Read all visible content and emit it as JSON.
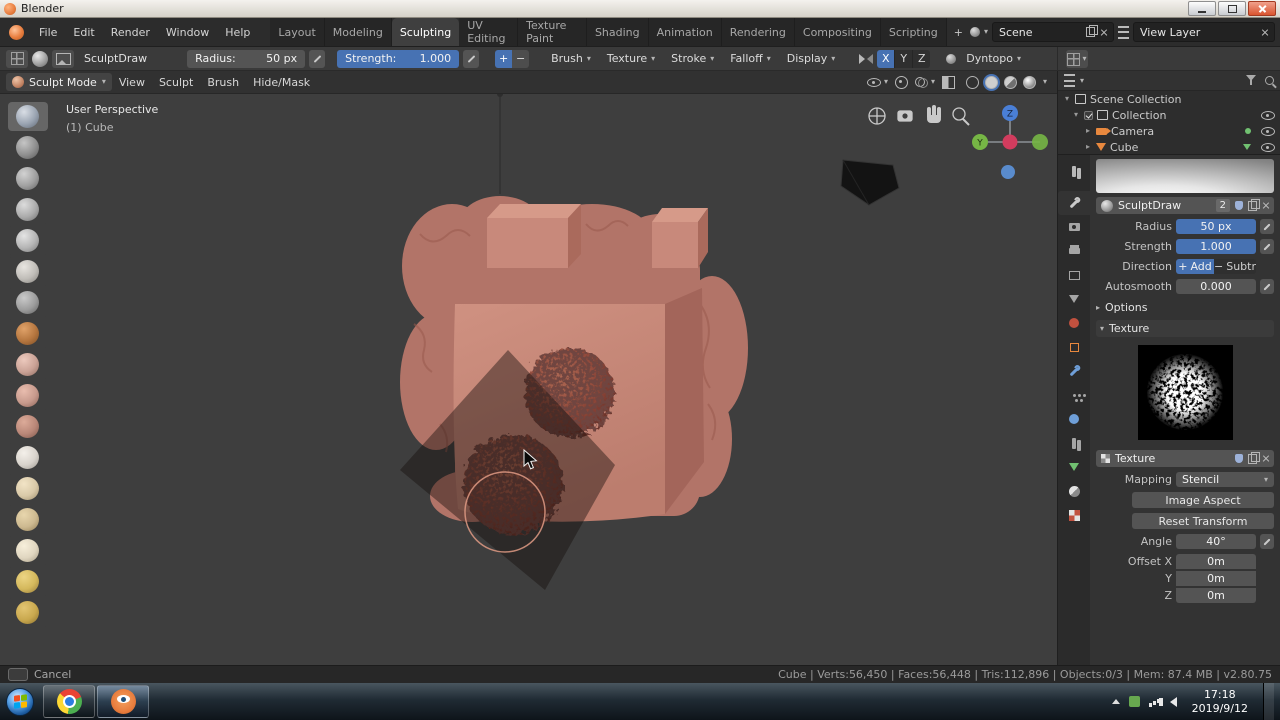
{
  "window": {
    "title": "Blender"
  },
  "icons": {
    "chevron_down": "▾",
    "caret_right": "▸"
  },
  "topbar": {
    "menus": [
      "File",
      "Edit",
      "Render",
      "Window",
      "Help"
    ],
    "tabs": [
      "Layout",
      "Modeling",
      "Sculpting",
      "UV Editing",
      "Texture Paint",
      "Shading",
      "Animation",
      "Rendering",
      "Compositing",
      "Scripting"
    ],
    "add_tab": "+",
    "scene_value": "Scene",
    "view_layer_value": "View Layer"
  },
  "tool_settings": {
    "brush_name": "SculptDraw",
    "radius_label": "Radius:",
    "radius_value": "50 px",
    "strength_label": "Strength:",
    "strength_value": "1.000",
    "add_glyph": "+",
    "subtract_glyph": "−",
    "menus": [
      "Brush",
      "Texture",
      "Stroke",
      "Falloff",
      "Display"
    ],
    "mirror_axes": [
      "X",
      "Y",
      "Z"
    ],
    "dyntopo_label": "Dyntopo"
  },
  "viewport": {
    "mode": "Sculpt Mode",
    "menus": [
      "View",
      "Sculpt",
      "Brush",
      "Hide/Mask"
    ],
    "overlay_title": "User Perspective",
    "overlay_subtitle": "(1) Cube",
    "gizmo_z": "Z",
    "gizmo_y": "Y"
  },
  "outliner": {
    "items": [
      {
        "label": "Scene Collection"
      },
      {
        "label": "Collection"
      },
      {
        "label": "Camera"
      },
      {
        "label": "Cube"
      }
    ]
  },
  "properties": {
    "brush_name": "SculptDraw",
    "brush_users": "2",
    "radius_label": "Radius",
    "radius_value": "50 px",
    "strength_label": "Strength",
    "strength_value": "1.000",
    "direction_label": "Direction",
    "direction_add": "Add",
    "direction_subtract": "Subtr",
    "autosmooth_label": "Autosmooth",
    "autosmooth_value": "0.000",
    "options_label": "Options",
    "texture_section": "Texture",
    "texture_name": "Texture",
    "mapping_label": "Mapping",
    "mapping_value": "Stencil",
    "image_aspect_button": "Image Aspect",
    "reset_transform_button": "Reset Transform",
    "angle_label": "Angle",
    "angle_value": "40°",
    "offset_x_label": "Offset X",
    "offset_x_value": "0m",
    "offset_y_label": "Y",
    "offset_y_value": "0m",
    "offset_z_label": "Z",
    "offset_z_value": "0m"
  },
  "status_bar": {
    "cancel_label": "Cancel",
    "stats": "Cube | Verts:56,450 | Faces:56,448 | Tris:112,896 | Objects:0/3 | Mem: 87.4 MB | v2.80.75"
  },
  "taskbar": {
    "time": "17:18",
    "date": "2019/9/12"
  },
  "colors": {
    "accent_blue": "#4772b3",
    "object_pink": "#c08072",
    "blender_orange": "#e87d3e"
  }
}
